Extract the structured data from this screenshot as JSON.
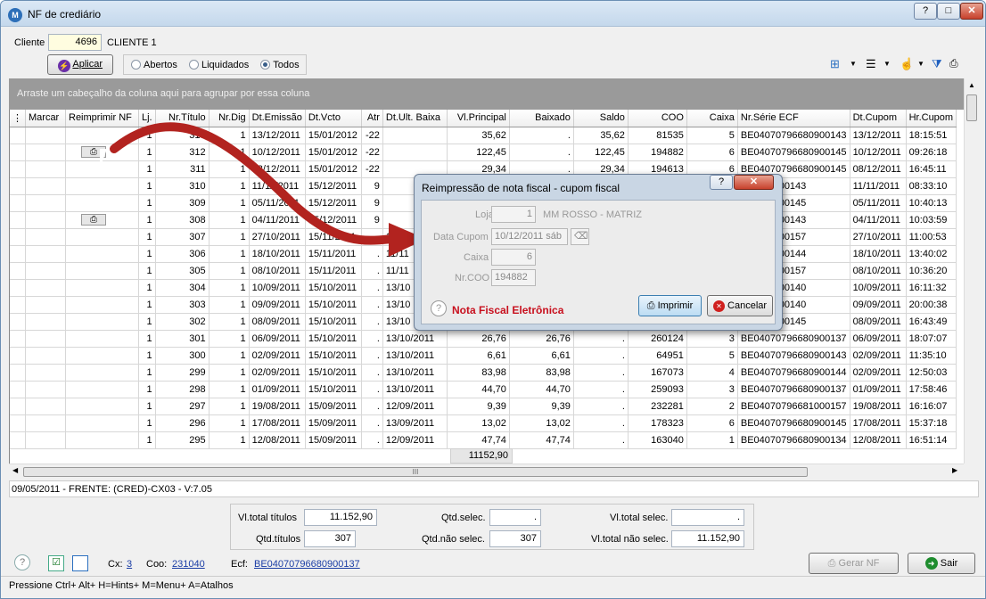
{
  "window": {
    "title": "NF de crediário",
    "help": "?",
    "maximize": "□",
    "close": "✕"
  },
  "header": {
    "cliente_label": "Cliente",
    "cliente_code": "4696",
    "cliente_name": "CLIENTE 1",
    "aplicar_label": "Aplicar",
    "radios": [
      {
        "label": "Abertos",
        "selected": false
      },
      {
        "label": "Liquidados",
        "selected": false
      },
      {
        "label": "Todos",
        "selected": true
      }
    ]
  },
  "grid": {
    "group_hint": "Arraste um cabeçalho da coluna aqui para agrupar por essa coluna",
    "columns": [
      "Marcar",
      "Reimprimir NF",
      "Lj.",
      "Nr.Título",
      "Nr.Dig",
      "Dt.Emissão",
      "Dt.Vcto",
      "Atr",
      "Dt.Ult. Baixa",
      "Vl.Principal",
      "Baixado",
      "Saldo",
      "COO",
      "Caixa",
      "Nr.Série ECF",
      "Dt.Cupom",
      "Hr.Cupom"
    ],
    "rows": [
      [
        "",
        "1",
        "313",
        "1",
        "13/12/2011",
        "15/01/2012",
        "-22",
        "",
        "35,62",
        ".",
        "35,62",
        "81535",
        "5",
        "BE04070796680900143",
        "13/12/2011",
        "18:15:51"
      ],
      [
        "printer",
        "1",
        "312",
        "1",
        "10/12/2011",
        "15/01/2012",
        "-22",
        "",
        "122,45",
        ".",
        "122,45",
        "194882",
        "6",
        "BE04070796680900145",
        "10/12/2011",
        "09:26:18"
      ],
      [
        "",
        "1",
        "311",
        "1",
        "08/12/2011",
        "15/01/2012",
        "-22",
        "",
        "29,34",
        ".",
        "29,34",
        "194613",
        "6",
        "BE04070796680900145",
        "08/12/2011",
        "16:45:11"
      ],
      [
        "",
        "1",
        "310",
        "1",
        "11/11/2011",
        "15/12/2011",
        "9",
        "",
        "",
        "",
        "",
        "",
        "",
        "796680900143",
        "11/11/2011",
        "08:33:10"
      ],
      [
        "",
        "1",
        "309",
        "1",
        "05/11/2011",
        "15/12/2011",
        "9",
        "",
        "",
        "",
        "",
        "",
        "",
        "796680900145",
        "05/11/2011",
        "10:40:13"
      ],
      [
        "printer",
        "1",
        "308",
        "1",
        "04/11/2011",
        "15/12/2011",
        "9",
        "",
        "",
        "",
        "",
        "",
        "",
        "796680900143",
        "04/11/2011",
        "10:03:59"
      ],
      [
        "",
        "1",
        "307",
        "1",
        "27/10/2011",
        "15/11/2011",
        ".",
        "11/11",
        "",
        "",
        "",
        "",
        "",
        "796681000157",
        "27/10/2011",
        "11:00:53"
      ],
      [
        "",
        "1",
        "306",
        "1",
        "18/10/2011",
        "15/11/2011",
        ".",
        "11/11",
        "",
        "",
        "",
        "",
        "",
        "796680900144",
        "18/10/2011",
        "13:40:02"
      ],
      [
        "",
        "1",
        "305",
        "1",
        "08/10/2011",
        "15/11/2011",
        ".",
        "11/11",
        "",
        "",
        "",
        "",
        "",
        "796681000157",
        "08/10/2011",
        "10:36:20"
      ],
      [
        "",
        "1",
        "304",
        "1",
        "10/09/2011",
        "15/10/2011",
        ".",
        "13/10",
        "",
        "",
        "",
        "",
        "",
        "796680900140",
        "10/09/2011",
        "16:11:32"
      ],
      [
        "",
        "1",
        "303",
        "1",
        "09/09/2011",
        "15/10/2011",
        ".",
        "13/10",
        "",
        "",
        "",
        "",
        "",
        "796680900140",
        "09/09/2011",
        "20:00:38"
      ],
      [
        "",
        "1",
        "302",
        "1",
        "08/09/2011",
        "15/10/2011",
        ".",
        "13/10",
        "",
        "",
        "",
        "",
        "",
        "796680900145",
        "08/09/2011",
        "16:43:49"
      ],
      [
        "",
        "1",
        "301",
        "1",
        "06/09/2011",
        "15/10/2011",
        ".",
        "13/10/2011",
        "26,76",
        "26,76",
        ".",
        "260124",
        "3",
        "BE04070796680900137",
        "06/09/2011",
        "18:07:07"
      ],
      [
        "",
        "1",
        "300",
        "1",
        "02/09/2011",
        "15/10/2011",
        ".",
        "13/10/2011",
        "6,61",
        "6,61",
        ".",
        "64951",
        "5",
        "BE04070796680900143",
        "02/09/2011",
        "11:35:10"
      ],
      [
        "",
        "1",
        "299",
        "1",
        "02/09/2011",
        "15/10/2011",
        ".",
        "13/10/2011",
        "83,98",
        "83,98",
        ".",
        "167073",
        "4",
        "BE04070796680900144",
        "02/09/2011",
        "12:50:03"
      ],
      [
        "",
        "1",
        "298",
        "1",
        "01/09/2011",
        "15/10/2011",
        ".",
        "13/10/2011",
        "44,70",
        "44,70",
        ".",
        "259093",
        "3",
        "BE04070796680900137",
        "01/09/2011",
        "17:58:46"
      ],
      [
        "",
        "1",
        "297",
        "1",
        "19/08/2011",
        "15/09/2011",
        ".",
        "12/09/2011",
        "9,39",
        "9,39",
        ".",
        "232281",
        "2",
        "BE04070796681000157",
        "19/08/2011",
        "16:16:07"
      ],
      [
        "",
        "1",
        "296",
        "1",
        "17/08/2011",
        "15/09/2011",
        ".",
        "13/09/2011",
        "13,02",
        "13,02",
        ".",
        "178323",
        "6",
        "BE04070796680900145",
        "17/08/2011",
        "15:37:18"
      ],
      [
        "",
        "1",
        "295",
        "1",
        "12/08/2011",
        "15/09/2011",
        ".",
        "12/09/2011",
        "47,74",
        "47,74",
        ".",
        "163040",
        "1",
        "BE04070796680900134",
        "12/08/2011",
        "16:51:14"
      ]
    ],
    "footer_total": "11152,90",
    "scroll_grip": "III"
  },
  "status_line": "09/05/2011 - FRENTE: (CRED)-CX03 - V:7.05",
  "totals": {
    "vl_total_titulos_label": "Vl.total títulos",
    "vl_total_titulos": "11.152,90",
    "qtd_titulos_label": "Qtd.títulos",
    "qtd_titulos": "307",
    "qtd_selec_label": "Qtd.selec.",
    "qtd_selec": ".",
    "qtd_nao_selec_label": "Qtd.não selec.",
    "qtd_nao_selec": "307",
    "vl_total_selec_label": "Vl.total selec.",
    "vl_total_selec": ".",
    "vl_total_nao_selec_label": "Vl.total não selec.",
    "vl_total_nao_selec": "11.152,90"
  },
  "info": {
    "cx_label": "Cx:",
    "cx": "3",
    "coo_label": "Coo:",
    "coo": "231040",
    "ecf_label": "Ecf:",
    "ecf": "BE04070796680900137"
  },
  "buttons": {
    "gerar_nf": "Gerar NF",
    "sair": "Sair"
  },
  "hints": "Pressione Ctrl+ Alt+ H=Hints+ M=Menu+ A=Atalhos",
  "dialog": {
    "title": "Reimpressão de nota fiscal - cupom fiscal",
    "help": "?",
    "close": "✕",
    "loja_label": "Loja",
    "loja": "1",
    "loja_name": "MM ROSSO - MATRIZ",
    "data_cupom_label": "Data Cupom",
    "data_cupom": "10/12/2011 sáb",
    "caixa_label": "Caixa",
    "caixa": "6",
    "nr_coo_label": "Nr.COO",
    "nr_coo": "194882",
    "nfe_label": "Nota Fiscal Eletrônica",
    "imprimir": "Imprimir",
    "cancelar": "Cancelar"
  },
  "colors": {
    "accent_red": "#c8101e",
    "arrow": "#b2231f"
  }
}
